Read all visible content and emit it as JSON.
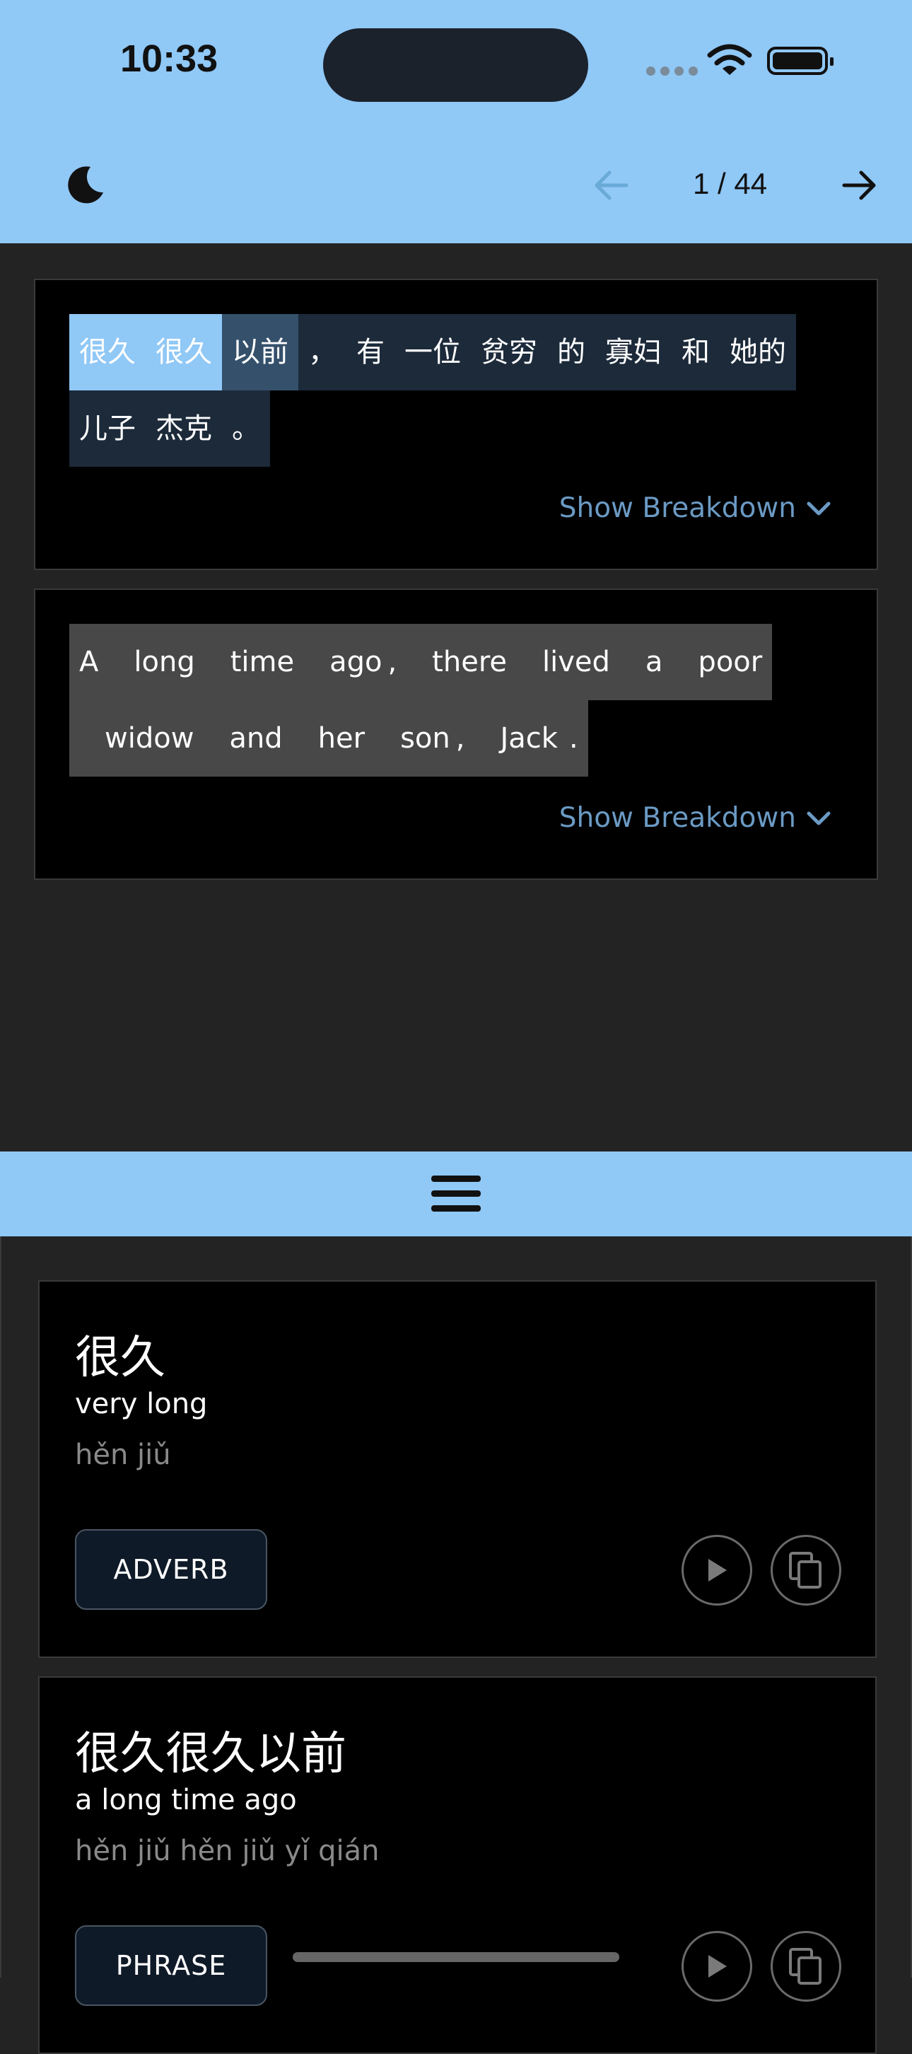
{
  "status": {
    "time": "10:33"
  },
  "toolbar": {
    "page": "1 / 44"
  },
  "sentences": [
    {
      "lang": "zh",
      "tokens": [
        "很久",
        "很久",
        "以前",
        "，",
        "有",
        "一位",
        "贫穷",
        "的",
        "寡妇",
        "和",
        "她的",
        "儿子",
        "杰克",
        "。"
      ],
      "toggle_label": "Show Breakdown"
    },
    {
      "lang": "en",
      "tokens": [
        "A",
        "long",
        "time",
        "ago",
        ",",
        "there",
        "lived",
        "a",
        "poor",
        "widow",
        "and",
        "her",
        "son",
        ",",
        "Jack",
        "."
      ],
      "toggle_label": "Show Breakdown"
    }
  ],
  "entries": [
    {
      "hanzi": "很久",
      "meaning": "very long",
      "pinyin": "hěn jiǔ",
      "pos": "ADVERB"
    },
    {
      "hanzi": "很久很久以前",
      "meaning": "a long time ago",
      "pinyin": "hěn jiǔ hěn jiǔ yǐ qián",
      "pos": "PHRASE"
    }
  ],
  "colors": {
    "accent": "#90c8f6",
    "link": "#6b9ac4",
    "card": "#000000",
    "background": "#232323"
  }
}
